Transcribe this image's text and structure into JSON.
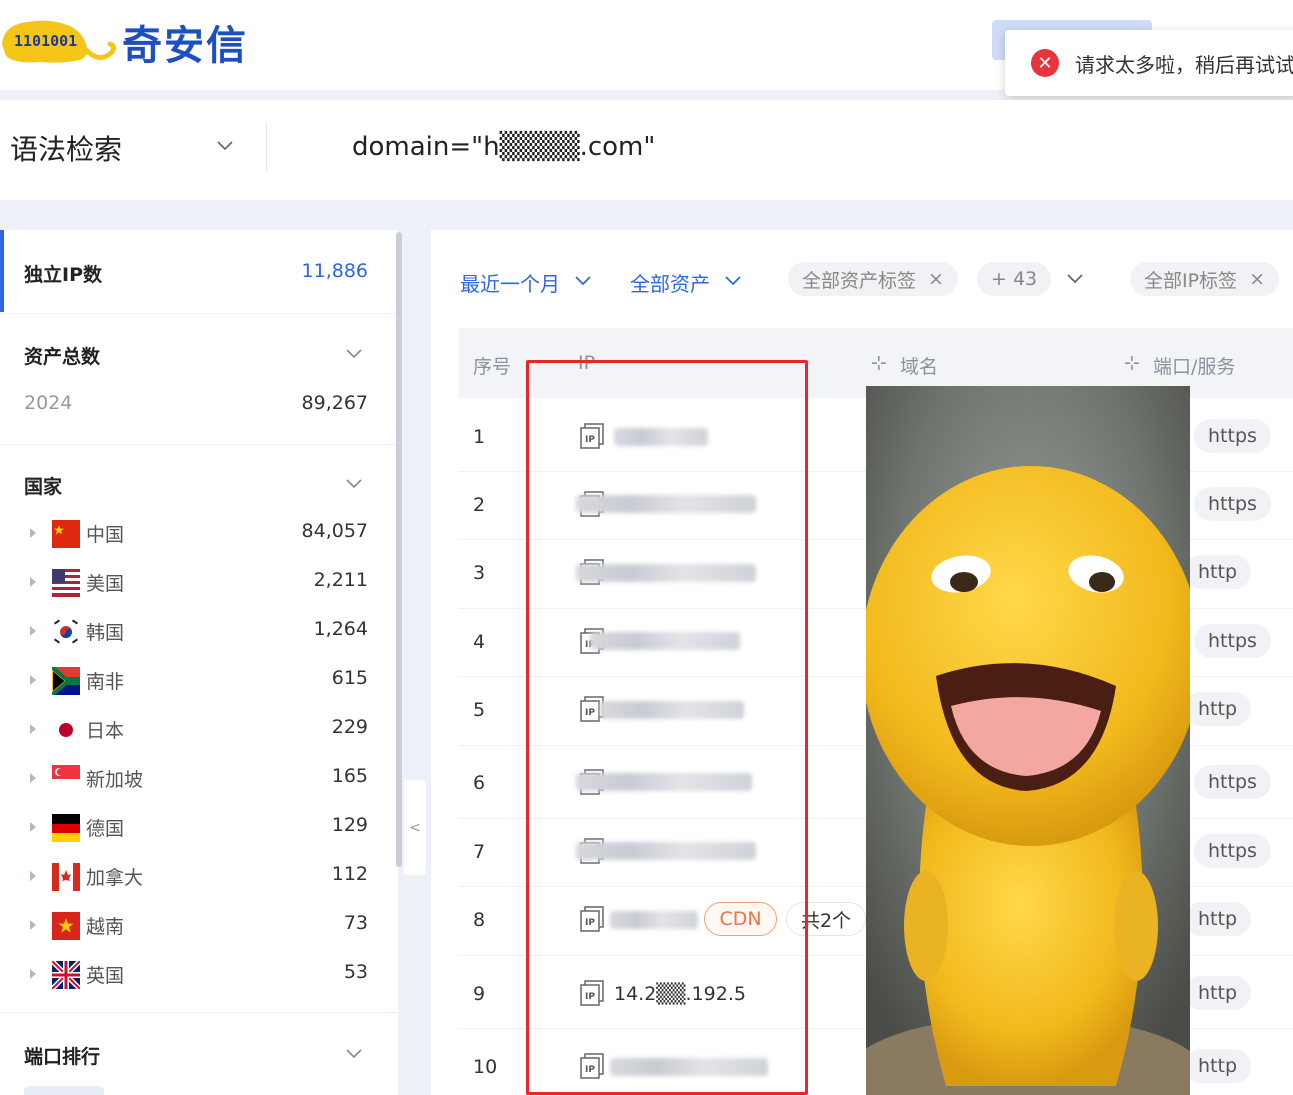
{
  "brand": {
    "name": "奇安信",
    "mascot_digits": "1101001"
  },
  "toast": {
    "message": "请求太多啦，稍后再试试"
  },
  "search": {
    "mode": "语法检索",
    "query": "domain=\"h▒▒▒▒.com\""
  },
  "stats": {
    "unique_ip": {
      "label": "独立IP数",
      "value": "11,886"
    },
    "assets": {
      "label": "资产总数",
      "year": "2024",
      "value": "89,267"
    },
    "country_title": "国家",
    "countries": [
      {
        "name": "中国",
        "count": "84,057",
        "flag": "cn"
      },
      {
        "name": "美国",
        "count": "2,211",
        "flag": "us"
      },
      {
        "name": "韩国",
        "count": "1,264",
        "flag": "kr"
      },
      {
        "name": "南非",
        "count": "615",
        "flag": "za"
      },
      {
        "name": "日本",
        "count": "229",
        "flag": "jp"
      },
      {
        "name": "新加坡",
        "count": "165",
        "flag": "sg"
      },
      {
        "name": "德国",
        "count": "129",
        "flag": "de"
      },
      {
        "name": "加拿大",
        "count": "112",
        "flag": "ca"
      },
      {
        "name": "越南",
        "count": "73",
        "flag": "vn"
      },
      {
        "name": "英国",
        "count": "53",
        "flag": "gb"
      }
    ],
    "ports_title": "端口排行"
  },
  "filters": {
    "time": "最近一个月",
    "scope": "全部资产",
    "tag1": "全部资产标签",
    "more": "+ 43",
    "tag2": "全部IP标签",
    "close_glyph": "×"
  },
  "table": {
    "headers": {
      "index": "序号",
      "ip": "IP",
      "domain": "域名",
      "port": "端口/服务"
    },
    "icon_label": "IP",
    "rows": [
      {
        "index": "1",
        "ip": "",
        "service": "https"
      },
      {
        "index": "2",
        "ip": "",
        "service": "https"
      },
      {
        "index": "3",
        "ip": "",
        "service": "http"
      },
      {
        "index": "4",
        "ip": "",
        "service": "https"
      },
      {
        "index": "5",
        "ip": "",
        "service": "http"
      },
      {
        "index": "6",
        "ip": "",
        "service": "https"
      },
      {
        "index": "7",
        "ip": "",
        "service": "https"
      },
      {
        "index": "8",
        "ip": "",
        "service": "http",
        "badge": "CDN",
        "total": "共2个"
      },
      {
        "index": "9",
        "ip": "14.2▒▒.192.5",
        "service": "http"
      },
      {
        "index": "10",
        "ip": "",
        "service": "http"
      }
    ]
  },
  "colors": {
    "primary": "#2f66e0",
    "logo": "#1d4fbf",
    "error": "#e8353b",
    "highlight": "#e8262b",
    "cdn": "#e8744a"
  }
}
